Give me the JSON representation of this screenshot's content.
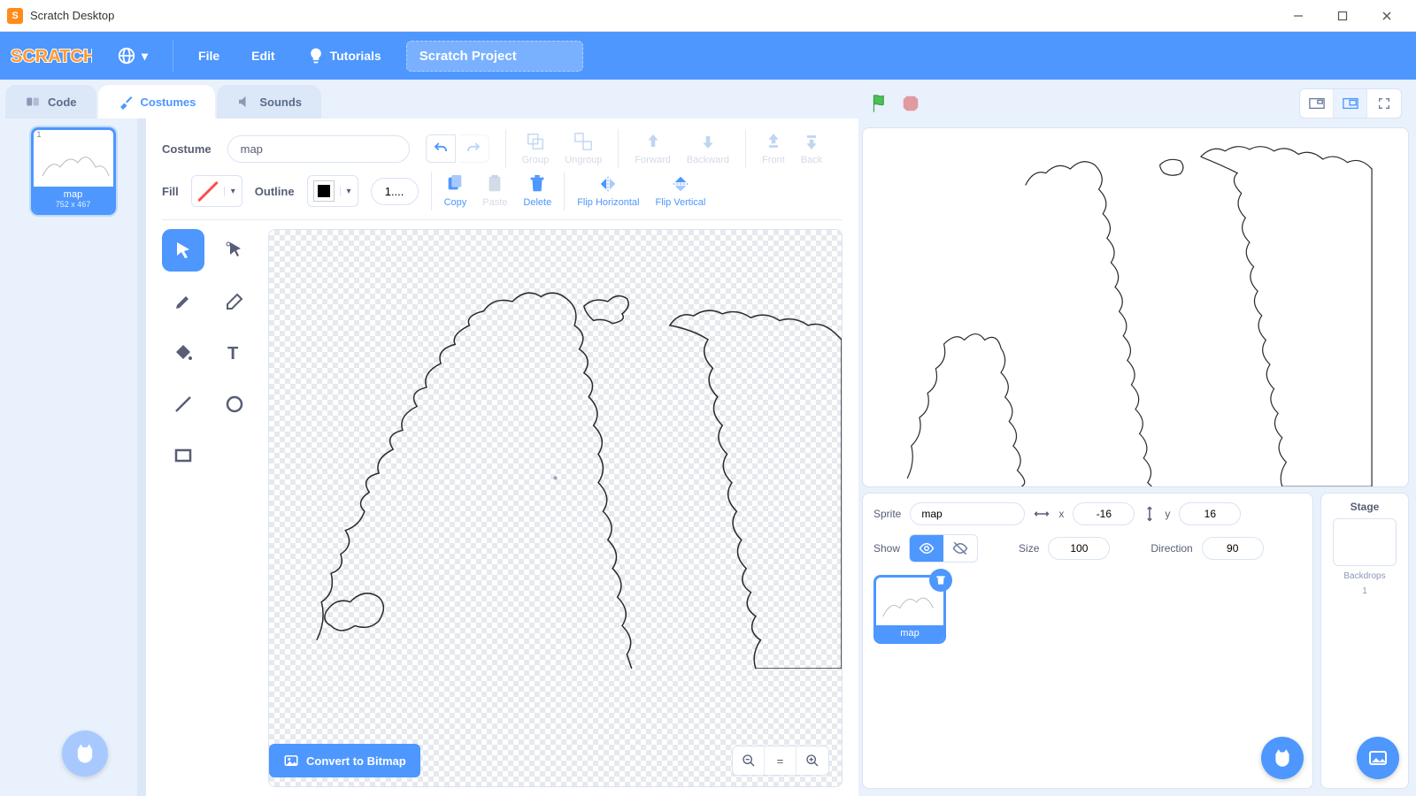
{
  "window": {
    "title": "Scratch Desktop"
  },
  "menu": {
    "file": "File",
    "edit": "Edit",
    "tutorials": "Tutorials",
    "project_name": "Scratch Project"
  },
  "tabs": {
    "code": "Code",
    "costumes": "Costumes",
    "sounds": "Sounds"
  },
  "costume_list": {
    "items": [
      {
        "index": "1",
        "name": "map",
        "dims": "752 x 467"
      }
    ]
  },
  "paint": {
    "costume_label": "Costume",
    "costume_name": "map",
    "fill_label": "Fill",
    "outline_label": "Outline",
    "stroke_width": "1....",
    "buttons": {
      "group": "Group",
      "ungroup": "Ungroup",
      "forward": "Forward",
      "backward": "Backward",
      "front": "Front",
      "back": "Back",
      "copy": "Copy",
      "paste": "Paste",
      "delete": "Delete",
      "flip_h": "Flip Horizontal",
      "flip_v": "Flip Vertical"
    },
    "convert": "Convert to Bitmap"
  },
  "sprite_info": {
    "sprite_label": "Sprite",
    "name": "map",
    "x_label": "x",
    "x": "-16",
    "y_label": "y",
    "y": "16",
    "show_label": "Show",
    "size_label": "Size",
    "size": "100",
    "direction_label": "Direction",
    "direction": "90",
    "thumb_name": "map"
  },
  "stage_panel": {
    "title": "Stage",
    "backdrops_label": "Backdrops",
    "backdrops_count": "1"
  },
  "colors": {
    "accent": "#4d97ff"
  }
}
